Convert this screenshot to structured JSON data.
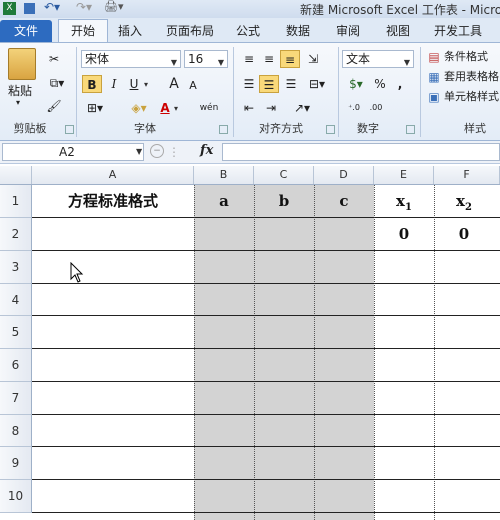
{
  "window": {
    "title": "新建 Microsoft Excel 工作表 - Microsoft"
  },
  "tabs": [
    {
      "label": "文件"
    },
    {
      "label": "开始"
    },
    {
      "label": "插入"
    },
    {
      "label": "页面布局"
    },
    {
      "label": "公式"
    },
    {
      "label": "数据"
    },
    {
      "label": "审阅"
    },
    {
      "label": "视图"
    },
    {
      "label": "开发工具"
    }
  ],
  "ribbon": {
    "clipboard": {
      "paste": "粘贴",
      "group": "剪贴板"
    },
    "font": {
      "name": "宋体",
      "size": "16",
      "bold": "B",
      "italic": "I",
      "underline": "U",
      "grow": "A",
      "shrink": "A",
      "color_letter": "A",
      "phonetic": "wén",
      "group": "字体"
    },
    "align": {
      "group": "对齐方式"
    },
    "number": {
      "format": "文本",
      "percent": "%",
      "comma": ",",
      "group": "数字"
    },
    "styles": {
      "conditional": "条件格式",
      "table": "套用表格格",
      "cell": "单元格样式",
      "group": "样式"
    }
  },
  "formula_bar": {
    "name_box": "A2",
    "fx": "fx",
    "content": ""
  },
  "columns": [
    "A",
    "B",
    "C",
    "D",
    "E",
    "F"
  ],
  "rows": [
    "1",
    "2",
    "3",
    "4",
    "5",
    "6",
    "7",
    "8",
    "9",
    "10"
  ],
  "cells": {
    "A1": "方程标准格式",
    "B1": "a",
    "C1": "b",
    "D1": "c",
    "E1": "x",
    "E1_sub": "1",
    "F1": "x",
    "F1_sub": "2",
    "E2": "0",
    "F2": "0"
  },
  "colors": {
    "selected_tab": "#2d6bc0",
    "shaded_columns": "#d3d3d3",
    "highlight": "#f9d97a"
  }
}
